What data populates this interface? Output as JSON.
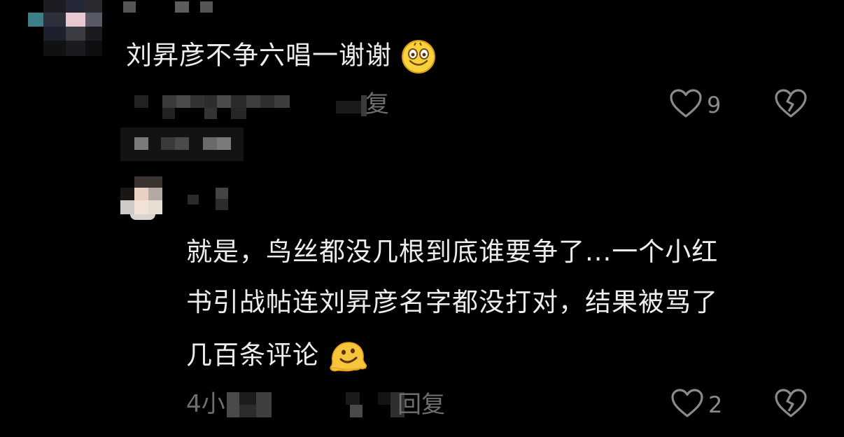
{
  "comment": {
    "text": "刘昇彦不争六唱一谢谢",
    "emoji": "smiley-face-icon",
    "reply_label": "复",
    "likes": "9"
  },
  "reply": {
    "line1": "就是，鸟丝都没几根到底谁要争了...一个小红",
    "line2": "书引战帖连刘昇彦名字都没打对，结果被骂了",
    "line3": "几百条评论",
    "emoji": "melting-face-icon",
    "time_fragment": "4小",
    "reply_label": "回复",
    "likes": "2"
  },
  "colors": {
    "background": "#000000",
    "text": "#ededed",
    "meta": "#6e6e6e",
    "icon": "#8a8a8a"
  }
}
